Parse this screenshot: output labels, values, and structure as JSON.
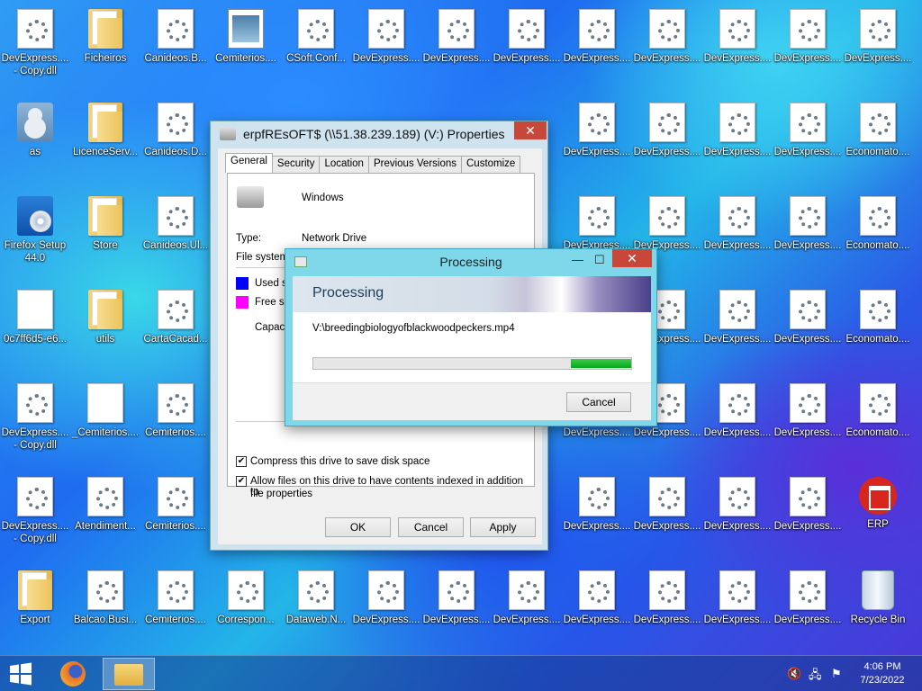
{
  "desktop": {
    "icons": [
      {
        "label": "DevExpress....\n- Copy.dll",
        "type": "dll"
      },
      {
        "label": "Ficheiros",
        "type": "folder"
      },
      {
        "label": "Canideos.B...",
        "type": "dll"
      },
      {
        "label": "Cemiterios....",
        "type": "app"
      },
      {
        "label": "CSoft.Conf...",
        "type": "dll"
      },
      {
        "label": "DevExpress....",
        "type": "dll"
      },
      {
        "label": "DevExpress....",
        "type": "dll"
      },
      {
        "label": "DevExpress....",
        "type": "dll"
      },
      {
        "label": "DevExpress....",
        "type": "dll"
      },
      {
        "label": "DevExpress....",
        "type": "dll"
      },
      {
        "label": "DevExpress....",
        "type": "dll"
      },
      {
        "label": "DevExpress....",
        "type": "dll"
      },
      {
        "label": "DevExpress....",
        "type": "dll"
      },
      {
        "label": "as",
        "type": "user"
      },
      {
        "label": "LicenceServ...",
        "type": "folder"
      },
      {
        "label": "Canideos.D...",
        "type": "dll"
      },
      {
        "label": "DevExpress....",
        "type": "dll"
      },
      {
        "label": "DevExpress....",
        "type": "dll"
      },
      {
        "label": "DevExpress....",
        "type": "dll"
      },
      {
        "label": "DevExpress....",
        "type": "dll"
      },
      {
        "label": "Economato....",
        "type": "dll"
      },
      {
        "label": "Firefox Setup\n44.0",
        "type": "setup"
      },
      {
        "label": "Store",
        "type": "folder"
      },
      {
        "label": "Canideos.Ul...",
        "type": "dll"
      },
      {
        "label": "DevExpress....",
        "type": "dll"
      },
      {
        "label": "DevExpress....",
        "type": "dll"
      },
      {
        "label": "DevExpress....",
        "type": "dll"
      },
      {
        "label": "DevExpress....",
        "type": "dll"
      },
      {
        "label": "Economato....",
        "type": "dll"
      },
      {
        "label": "0c7ff6d5-e6...",
        "type": "doc"
      },
      {
        "label": "utils",
        "type": "folder"
      },
      {
        "label": "CartaCacad...",
        "type": "dll"
      },
      {
        "label": "DevExpress....",
        "type": "dll"
      },
      {
        "label": "DevExpress....",
        "type": "dll"
      },
      {
        "label": "DevExpress....",
        "type": "dll"
      },
      {
        "label": "DevExpress....",
        "type": "dll"
      },
      {
        "label": "Economato....",
        "type": "dll"
      },
      {
        "label": "DevExpress....\n- Copy.dll",
        "type": "dll"
      },
      {
        "label": "_Cemiterios....",
        "type": "doc"
      },
      {
        "label": "Cemiterios....",
        "type": "dll"
      },
      {
        "label": "DevExpress....",
        "type": "dll"
      },
      {
        "label": "DevExpress....",
        "type": "dll"
      },
      {
        "label": "DevExpress....",
        "type": "dll"
      },
      {
        "label": "DevExpress....",
        "type": "dll"
      },
      {
        "label": "Economato....",
        "type": "dll"
      },
      {
        "label": "DevExpress....\n- Copy.dll",
        "type": "dll"
      },
      {
        "label": "Atendiment...",
        "type": "dll"
      },
      {
        "label": "Cemiterios....",
        "type": "dll"
      },
      {
        "label": "DevExpress....",
        "type": "dll"
      },
      {
        "label": "DevExpress....",
        "type": "dll"
      },
      {
        "label": "DevExpress....",
        "type": "dll"
      },
      {
        "label": "DevExpress....",
        "type": "dll"
      },
      {
        "label": "ERP",
        "type": "erp"
      },
      {
        "label": "Export",
        "type": "folder"
      },
      {
        "label": "Balcao.Busi...",
        "type": "dll"
      },
      {
        "label": "Cemiterios....",
        "type": "dll"
      },
      {
        "label": "Correspon...",
        "type": "dll"
      },
      {
        "label": "Dataweb.N...",
        "type": "dll"
      },
      {
        "label": "DevExpress....",
        "type": "dll"
      },
      {
        "label": "DevExpress....",
        "type": "dll"
      },
      {
        "label": "DevExpress....",
        "type": "dll"
      },
      {
        "label": "DevExpress....",
        "type": "dll"
      },
      {
        "label": "DevExpress....",
        "type": "dll"
      },
      {
        "label": "DevExpress....",
        "type": "dll"
      },
      {
        "label": "DevExpress....",
        "type": "dll"
      },
      {
        "label": "Recycle Bin",
        "type": "bin"
      }
    ]
  },
  "properties": {
    "title": "erpfREsOFT$ (\\\\51.38.239.189) (V:) Properties",
    "close": "✕",
    "tabs": [
      "General",
      "Security",
      "Location",
      "Previous Versions",
      "Customize"
    ],
    "drive_name": "Windows",
    "type_label": "Type:",
    "type_value": "Network Drive",
    "fs_label": "File system:",
    "used_label": "Used s",
    "free_label": "Free sp",
    "capacity_label": "Capaci",
    "compress_label": "Compress this drive to save disk space",
    "index_label": "Allow files on this drive to have contents indexed in addition to",
    "index_label2": "file properties",
    "ok": "OK",
    "cancel": "Cancel",
    "apply": "Apply",
    "used_color": "#0000ff",
    "free_color": "#ff00ff"
  },
  "processing": {
    "title": "Processing",
    "heading": "Processing",
    "file": "V:\\breedingbiologyofblackwoodpeckers.mp4",
    "cancel": "Cancel",
    "minimize": "—",
    "maximize": "☐",
    "close": "✕",
    "progress": {
      "start_fraction": 0.81,
      "end_fraction": 1.0,
      "color": "#06a81c"
    }
  },
  "taskbar": {
    "time": "4:06 PM",
    "date": "7/23/2022"
  }
}
